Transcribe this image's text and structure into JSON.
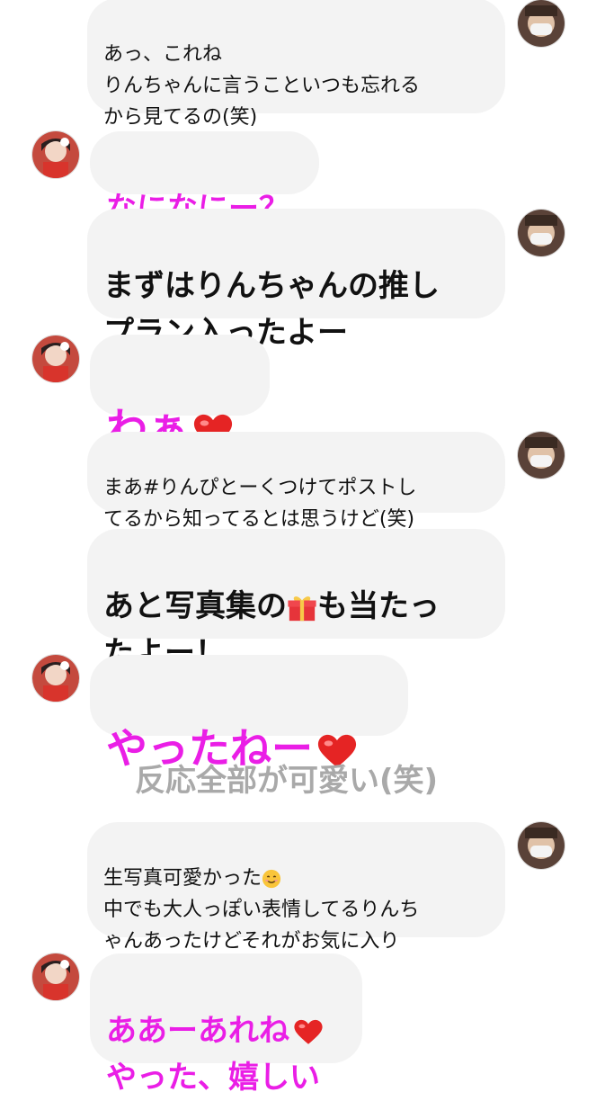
{
  "messages": [
    {
      "side": "right",
      "text": "あっ、これね\nりんちゃんに言うこといつも忘れる\nから見てるの(笑)"
    },
    {
      "side": "left",
      "text": "なになにー？"
    },
    {
      "side": "right",
      "text": "まずはりんちゃんの推し\nプラン入ったよー"
    },
    {
      "side": "left",
      "text": "わぁ",
      "emoji": "heart-icon"
    },
    {
      "side": "right",
      "text": "まあ#りんぴとーくつけてポストし\nてるから知ってるとは思うけど(笑)"
    },
    {
      "side": "right",
      "line1_before": "あと写真集の",
      "line1_after": "も当たっ",
      "line2": "たよー！",
      "emoji": "gift-icon"
    },
    {
      "side": "left",
      "text": "やったねー",
      "emoji": "heart-icon"
    },
    {
      "side": "right",
      "line1_before": "生写真可愛かった",
      "emoji": "smile-icon",
      "line2": "中でも大人っぽい表情してるりんち",
      "line3": "ゃんあったけどそれがお気に入り"
    },
    {
      "side": "left",
      "line1": "ああーあれね",
      "line2": "やった、嬉しい",
      "emoji": "heart-icon"
    }
  ],
  "annotation": "反応全部が可愛い(笑)",
  "colors": {
    "pink": "#ea1ee6",
    "bubble": "#f3f3f3",
    "annotation": "#a9a9a9"
  }
}
